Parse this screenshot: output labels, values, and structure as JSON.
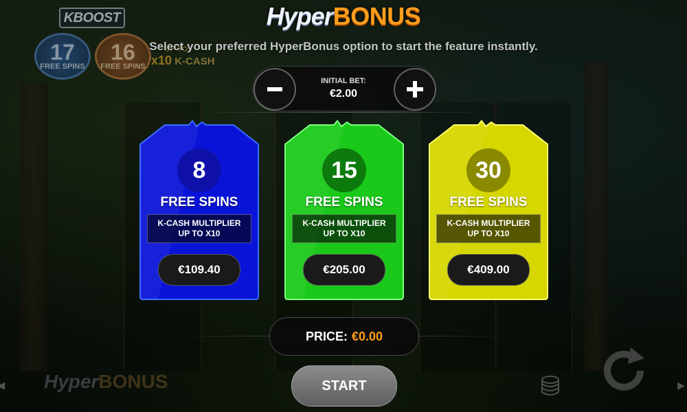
{
  "title": {
    "hyper": "Hyper",
    "bonus": "BONUS"
  },
  "subtitle": "Select your preferred HyperBonus option to start the feature instantly.",
  "hud": {
    "kboost": "KBOOST",
    "chip_a": {
      "number": "17",
      "label": "FREE SPINS"
    },
    "chip_b": {
      "number": "16",
      "label": "FREE SPINS"
    },
    "kcash_up": "UP TO",
    "kcash_mult": "x10",
    "kcash_label": "K-CASH"
  },
  "bet": {
    "minus_label": "−",
    "plus_label": "+",
    "label": "INITIAL BET:",
    "value": "€2.00"
  },
  "options": [
    {
      "spins": "8",
      "spins_label": "FREE SPINS",
      "mult_line1": "K-CASH MULTIPLIER",
      "mult_line2": "UP TO X10",
      "price": "€109.40",
      "color": "#0a14d8"
    },
    {
      "spins": "15",
      "spins_label": "FREE SPINS",
      "mult_line1": "K-CASH MULTIPLIER",
      "mult_line2": "UP TO X10",
      "price": "€205.00",
      "color": "#1ac91a"
    },
    {
      "spins": "30",
      "spins_label": "FREE SPINS",
      "mult_line1": "K-CASH MULTIPLIER",
      "mult_line2": "UP TO X10",
      "price": "€409.00",
      "color": "#d6d600"
    }
  ],
  "price": {
    "label": "PRICE:",
    "value": "€0.00"
  },
  "start_label": "START",
  "footer_logo": {
    "hyper": "Hyper",
    "bonus": "BONUS"
  },
  "icons": {
    "minus": "minus-icon",
    "plus": "plus-icon",
    "coins": "coins-stack-icon",
    "spin": "autospin-icon"
  }
}
